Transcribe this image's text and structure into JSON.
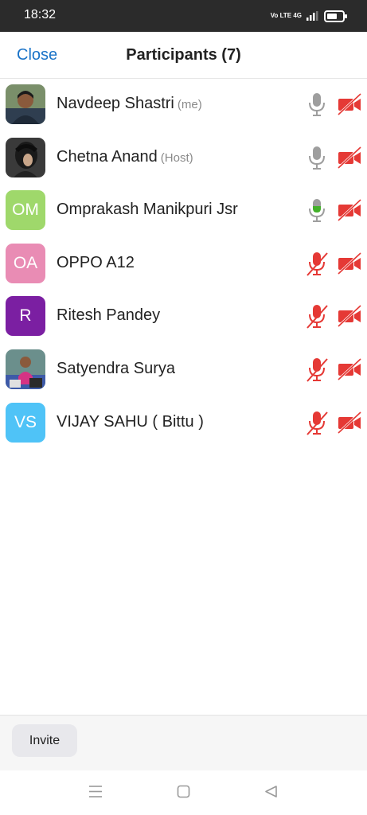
{
  "status_bar": {
    "time": "18:32",
    "network_text": "Vo LTE 4G"
  },
  "header": {
    "close_label": "Close",
    "title": "Participants (7)"
  },
  "participants": [
    {
      "name": "Navdeep Shastri",
      "tag": "(me)",
      "avatar": "photo",
      "audio": "unmuted",
      "video": "off"
    },
    {
      "name": "Chetna Anand",
      "tag": "(Host)",
      "avatar": "photo",
      "audio": "unmuted",
      "video": "off"
    },
    {
      "name": "Omprakash Manikpuri Jsr",
      "tag": "",
      "avatar": "OM",
      "avatar_color": "#9fd86b",
      "audio": "speaking",
      "video": "off"
    },
    {
      "name": "OPPO A12",
      "tag": "",
      "avatar": "OA",
      "avatar_color": "#e98cb4",
      "audio": "muted",
      "video": "off"
    },
    {
      "name": "Ritesh Pandey",
      "tag": "",
      "avatar": "R",
      "avatar_color": "#7b1fa2",
      "audio": "muted",
      "video": "off"
    },
    {
      "name": "Satyendra Surya",
      "tag": "",
      "avatar": "photo",
      "audio": "muted",
      "video": "off"
    },
    {
      "name": "VIJAY SAHU ( Bittu )",
      "tag": "",
      "avatar": "VS",
      "avatar_color": "#4fc3f7",
      "audio": "muted",
      "video": "off"
    }
  ],
  "footer": {
    "invite_label": "Invite"
  },
  "colors": {
    "accent": "#1a73c8",
    "muted_red": "#e53935",
    "speaking_green": "#43b02a",
    "icon_gray": "#9e9e9e"
  }
}
